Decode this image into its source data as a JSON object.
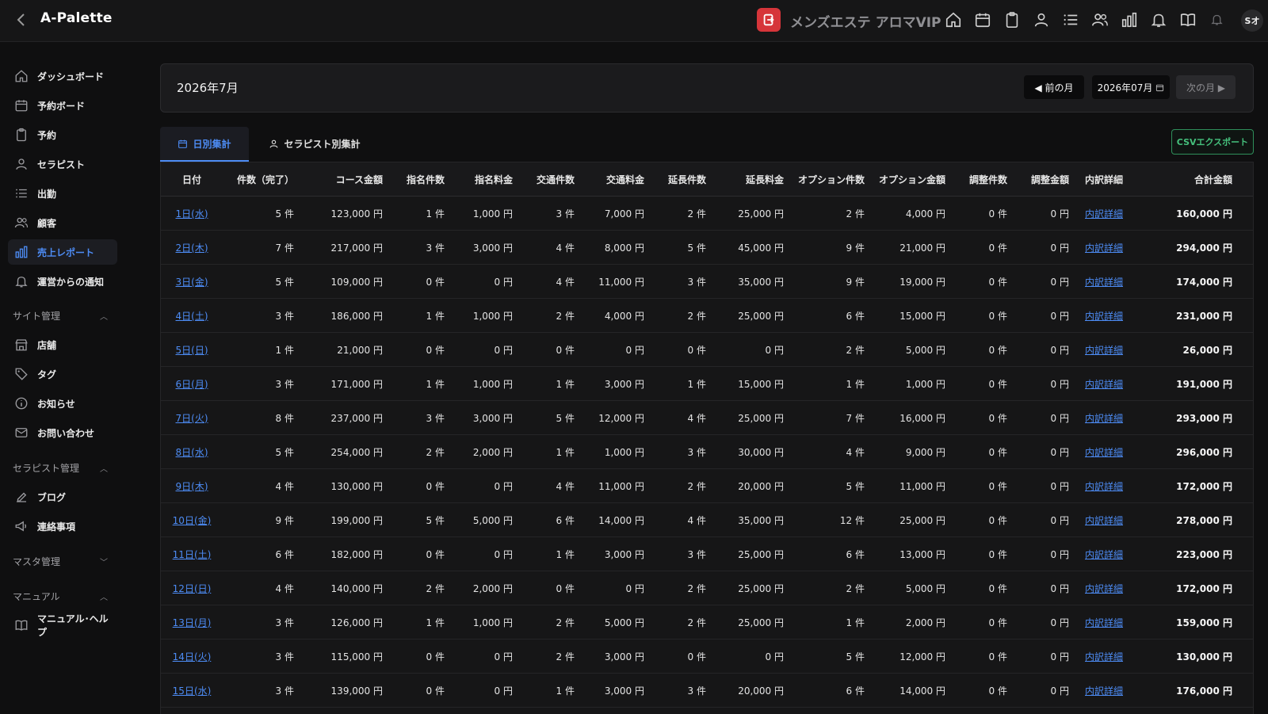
{
  "app": {
    "title": "A-Palette",
    "shop_name": "メンズエステ アロマVIP",
    "avatar_initials": "Sオ"
  },
  "colors": {
    "accent": "#4d8cf5",
    "brand_red": "#d6353a",
    "csv_green": "#45c07c",
    "background": "#0f0f10"
  },
  "top_icons": [
    "home-icon",
    "calendar-icon",
    "clipboard-icon",
    "user-icon",
    "list-icon",
    "users-icon",
    "bar-chart-icon",
    "bell-icon",
    "book-icon",
    "bell-small-icon"
  ],
  "sidebar": {
    "items": [
      {
        "label": "ダッシュボード",
        "icon": "home-icon"
      },
      {
        "label": "予約ボード",
        "icon": "calendar-icon"
      },
      {
        "label": "予約",
        "icon": "clipboard-icon"
      },
      {
        "label": "セラピスト",
        "icon": "user-icon"
      },
      {
        "label": "出勤",
        "icon": "list-icon"
      },
      {
        "label": "顧客",
        "icon": "users-icon"
      },
      {
        "label": "売上レポート",
        "icon": "bar-chart-icon",
        "active": true
      },
      {
        "label": "運営からの通知",
        "icon": "bell-icon"
      }
    ],
    "section_site": "サイト管理",
    "site_items": [
      {
        "label": "店舗",
        "icon": "store-icon"
      },
      {
        "label": "タグ",
        "icon": "tag-icon"
      },
      {
        "label": "お知らせ",
        "icon": "info-icon"
      },
      {
        "label": "お問い合わせ",
        "icon": "mail-icon"
      }
    ],
    "section_therapist": "セラピスト管理",
    "therapist_items": [
      {
        "label": "ブログ",
        "icon": "edit-icon"
      },
      {
        "label": "連絡事項",
        "icon": "megaphone-icon"
      }
    ],
    "section_master": "マスタ管理",
    "section_manual": "マニュアル",
    "manual_items": [
      {
        "label": "マニュアル･ヘルプ",
        "icon": "book-icon"
      }
    ]
  },
  "month": {
    "title": "2026年7月",
    "prev_label": "◀ 前の月",
    "date_value": "2026年07月",
    "next_label": "次の月 ▶"
  },
  "tabs": {
    "daily": "日別集計",
    "therapist": "セラピスト別集計"
  },
  "csv_label": "CSVエクスポート",
  "table": {
    "headers": [
      "日付",
      "件数（完了）",
      "コース金額",
      "指名件数",
      "指名料金",
      "交通件数",
      "交通料金",
      "延長件数",
      "延長料金",
      "オプション件数",
      "オプション金額",
      "調整件数",
      "調整金額",
      "内訳詳細",
      "合計金額"
    ],
    "rows": [
      [
        "1日(水)",
        "5 件",
        "123,000 円",
        "1 件",
        "1,000 円",
        "3 件",
        "7,000 円",
        "2 件",
        "25,000 円",
        "2 件",
        "4,000 円",
        "0 件",
        "0 円",
        "内訳詳細",
        "160,000 円"
      ],
      [
        "2日(木)",
        "7 件",
        "217,000 円",
        "3 件",
        "3,000 円",
        "4 件",
        "8,000 円",
        "5 件",
        "45,000 円",
        "9 件",
        "21,000 円",
        "0 件",
        "0 円",
        "内訳詳細",
        "294,000 円"
      ],
      [
        "3日(金)",
        "5 件",
        "109,000 円",
        "0 件",
        "0 円",
        "4 件",
        "11,000 円",
        "3 件",
        "35,000 円",
        "9 件",
        "19,000 円",
        "0 件",
        "0 円",
        "内訳詳細",
        "174,000 円"
      ],
      [
        "4日(土)",
        "3 件",
        "186,000 円",
        "1 件",
        "1,000 円",
        "2 件",
        "4,000 円",
        "2 件",
        "25,000 円",
        "6 件",
        "15,000 円",
        "0 件",
        "0 円",
        "内訳詳細",
        "231,000 円"
      ],
      [
        "5日(日)",
        "1 件",
        "21,000 円",
        "0 件",
        "0 円",
        "0 件",
        "0 円",
        "0 件",
        "0 円",
        "2 件",
        "5,000 円",
        "0 件",
        "0 円",
        "内訳詳細",
        "26,000 円"
      ],
      [
        "6日(月)",
        "3 件",
        "171,000 円",
        "1 件",
        "1,000 円",
        "1 件",
        "3,000 円",
        "1 件",
        "15,000 円",
        "1 件",
        "1,000 円",
        "0 件",
        "0 円",
        "内訳詳細",
        "191,000 円"
      ],
      [
        "7日(火)",
        "8 件",
        "237,000 円",
        "3 件",
        "3,000 円",
        "5 件",
        "12,000 円",
        "4 件",
        "25,000 円",
        "7 件",
        "16,000 円",
        "0 件",
        "0 円",
        "内訳詳細",
        "293,000 円"
      ],
      [
        "8日(水)",
        "5 件",
        "254,000 円",
        "2 件",
        "2,000 円",
        "1 件",
        "1,000 円",
        "3 件",
        "30,000 円",
        "4 件",
        "9,000 円",
        "0 件",
        "0 円",
        "内訳詳細",
        "296,000 円"
      ],
      [
        "9日(木)",
        "4 件",
        "130,000 円",
        "0 件",
        "0 円",
        "4 件",
        "11,000 円",
        "2 件",
        "20,000 円",
        "5 件",
        "11,000 円",
        "0 件",
        "0 円",
        "内訳詳細",
        "172,000 円"
      ],
      [
        "10日(金)",
        "9 件",
        "199,000 円",
        "5 件",
        "5,000 円",
        "6 件",
        "14,000 円",
        "4 件",
        "35,000 円",
        "12 件",
        "25,000 円",
        "0 件",
        "0 円",
        "内訳詳細",
        "278,000 円"
      ],
      [
        "11日(土)",
        "6 件",
        "182,000 円",
        "0 件",
        "0 円",
        "1 件",
        "3,000 円",
        "3 件",
        "25,000 円",
        "6 件",
        "13,000 円",
        "0 件",
        "0 円",
        "内訳詳細",
        "223,000 円"
      ],
      [
        "12日(日)",
        "4 件",
        "140,000 円",
        "2 件",
        "2,000 円",
        "0 件",
        "0 円",
        "2 件",
        "25,000 円",
        "2 件",
        "5,000 円",
        "0 件",
        "0 円",
        "内訳詳細",
        "172,000 円"
      ],
      [
        "13日(月)",
        "3 件",
        "126,000 円",
        "1 件",
        "1,000 円",
        "2 件",
        "5,000 円",
        "2 件",
        "25,000 円",
        "1 件",
        "2,000 円",
        "0 件",
        "0 円",
        "内訳詳細",
        "159,000 円"
      ],
      [
        "14日(火)",
        "3 件",
        "115,000 円",
        "0 件",
        "0 円",
        "2 件",
        "3,000 円",
        "0 件",
        "0 円",
        "5 件",
        "12,000 円",
        "0 件",
        "0 円",
        "内訳詳細",
        "130,000 円"
      ],
      [
        "15日(水)",
        "3 件",
        "139,000 円",
        "0 件",
        "0 円",
        "1 件",
        "3,000 円",
        "3 件",
        "20,000 円",
        "6 件",
        "14,000 円",
        "0 件",
        "0 円",
        "内訳詳細",
        "176,000 円"
      ]
    ]
  }
}
